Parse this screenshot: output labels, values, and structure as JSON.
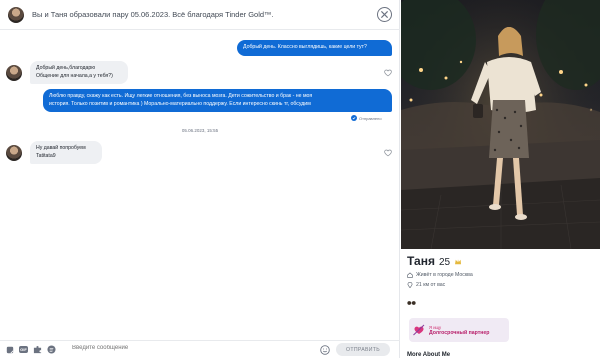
{
  "chat": {
    "header": {
      "title": "Вы и Таня образовали пару 05.06.2023. Всё благодаря Tinder Gold™."
    },
    "messages": [
      {
        "dir": "out",
        "text": "Добрый день. Классно выглядишь, какие цели тут?"
      },
      {
        "dir": "in",
        "lines": [
          "Добрый день,благодарю",
          "Общение для начала,а у тебя?)"
        ]
      },
      {
        "dir": "out",
        "lines": [
          "Люблю правду, скажу как есть. Ищу легкие отношения, без выноса мозга. Дети сожительство и брак - не моя",
          "история. Только позитив и романтика ) Морально-материально поддержу. Если интересно скинь тг, обсудим"
        ]
      },
      {
        "dir": "in",
        "lines": [
          "Ну давай попробуем",
          "Tatitata9"
        ]
      }
    ],
    "status_sent": "Отправлено",
    "timestamp": "05.06.2023, 15:55",
    "composer": {
      "placeholder": "Введите сообщение",
      "gif_label": "GIF",
      "send_label": "ОТПРАВИТЬ"
    }
  },
  "profile": {
    "name": "Таня",
    "age": "25",
    "location": "Живёт в городе Москва",
    "distance": "21 км от вас",
    "looking_for_kicker": "Я ищу",
    "looking_for_value": "Долгосрочный партнер",
    "more_heading": "More About Me"
  },
  "colors": {
    "accent_blue": "#106bd5",
    "pink": "#ce2d6f",
    "bubble_in": "#eef0f3"
  }
}
